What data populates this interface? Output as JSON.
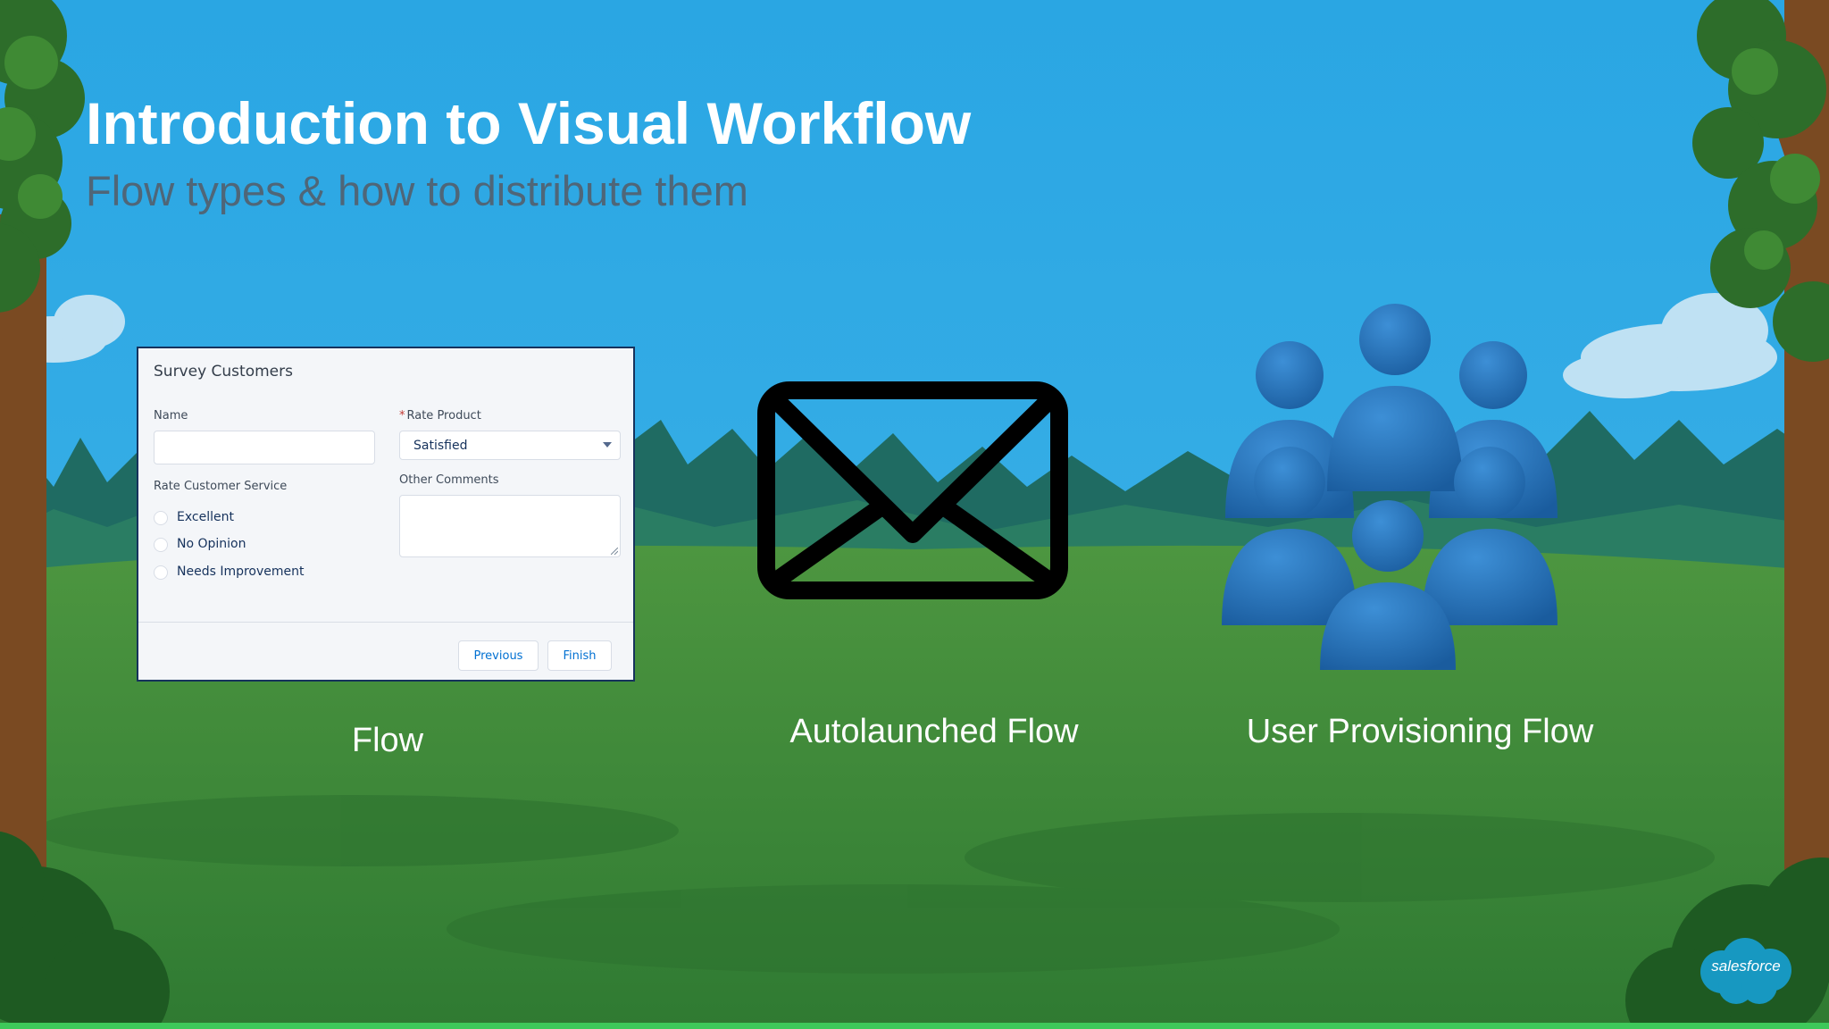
{
  "slide": {
    "title": "Introduction to Visual Workflow",
    "subtitle": "Flow types & how to distribute them"
  },
  "survey": {
    "title": "Survey Customers",
    "name_label": "Name",
    "rate_product_required_mark": "*",
    "rate_product_label": "Rate Product",
    "rate_product_value": "Satisfied",
    "rate_service_label": "Rate Customer Service",
    "options": [
      "Excellent",
      "No Opinion",
      "Needs Improvement"
    ],
    "other_comments_label": "Other Comments",
    "previous_label": "Previous",
    "finish_label": "Finish"
  },
  "captions": {
    "flow": "Flow",
    "autolaunched": "Autolaunched Flow",
    "user_provisioning": "User Provisioning Flow"
  },
  "icons": {
    "autolaunched": "envelope-icon",
    "user_provisioning": "users-group-icon"
  },
  "logo": {
    "text": "salesforce"
  },
  "colors": {
    "sky": "#2aa6e3",
    "grass": "#3f8a3a",
    "title": "#ffffff",
    "subtitle": "#4f6678",
    "accent_bar": "#3ec95a",
    "salesforce_blue": "#1798c1"
  }
}
